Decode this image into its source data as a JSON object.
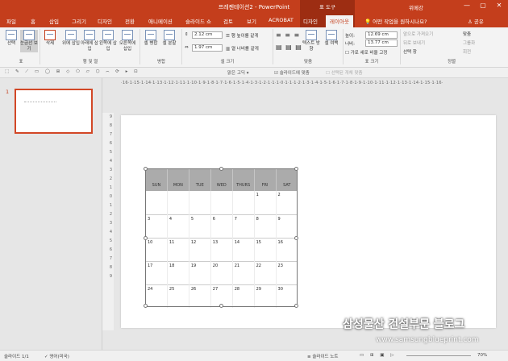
{
  "window": {
    "title": "프레젠테이션2 - PowerPoint",
    "context_group": "표 도구",
    "user": "위메강",
    "min": "—",
    "max": "▢",
    "close": "✕"
  },
  "tabs": {
    "file": "파일",
    "home": "홈",
    "insert": "삽입",
    "draw": "그리기",
    "design": "디자인",
    "transitions": "전환",
    "animations": "애니메이션",
    "slideshow": "슬라이드 쇼",
    "review": "검토",
    "view": "보기",
    "acrobat": "ACROBAT",
    "table_design": "디자인",
    "layout": "레이아웃",
    "search": "어떤 작업을 원하시나요?",
    "share": "공유"
  },
  "ribbon": {
    "select": "선택",
    "gridlines": "눈금선 보기",
    "delete": "삭제",
    "insert_above": "위에 삽입",
    "insert_below": "아래에 삽입",
    "insert_left": "왼쪽에 삽입",
    "insert_right": "오른쪽에 삽입",
    "merge_cells": "셀 병합",
    "split_cells": "셀 분할",
    "height_value": "2.12 cm",
    "width_value": "1.97 cm",
    "distribute_rows": "행 높이를 같게",
    "distribute_cols": "열 너비를 같게",
    "text_direction": "텍스트 방향",
    "cell_margins": "셀 여백",
    "tbl_height_label": "높이:",
    "tbl_height": "12.69 cm",
    "tbl_width_label": "너비:",
    "tbl_width": "13.77 cm",
    "lock_aspect": "가로 세로 비율 고정",
    "bring_forward": "앞으로 가져오기",
    "send_backward": "뒤로 보내기",
    "selection_pane": "선택 창",
    "align": "맞춤",
    "group": "그룹화",
    "rotate": "회전",
    "groups": {
      "table": "표",
      "rows_cols": "행 및 열",
      "merge": "병합",
      "cell_size": "셀 크기",
      "alignment": "맞춤",
      "table_size": "표 크기",
      "arrange": "정렬"
    }
  },
  "qat": {
    "font": "맑은 고딕",
    "snap": "슬라이드에 맞춤",
    "dim": "선택된 개체 맞춤"
  },
  "ruler": {
    "h": "·16·1·15·1·14·1·13·1·12·1·11·1·10·1·9·1·8·1·7·1·6·1·5·1·4·1·3·1·2·1·1·1·0·1·1·1·2·1·3·1·4·1·5·1·6·1·7·1·8·1·9·1·10·1·11·1·12·1·13·1·14·1·15·1·16·",
    "v": "9 8 7 6 5 4 3 2 1 0 1 2 3 4 5 6 7 8 9"
  },
  "thumbs": {
    "num": "1"
  },
  "calendar": {
    "days": [
      "SUN",
      "MON",
      "TUE",
      "WED",
      "THURS",
      "FRI",
      "SAT"
    ],
    "rows": [
      [
        "",
        "",
        "",
        "",
        "",
        "1",
        "2"
      ],
      [
        "3",
        "4",
        "5",
        "6",
        "7",
        "8",
        "9"
      ],
      [
        "10",
        "11",
        "12",
        "13",
        "14",
        "15",
        "16"
      ],
      [
        "17",
        "18",
        "19",
        "20",
        "21",
        "22",
        "23"
      ],
      [
        "24",
        "25",
        "26",
        "27",
        "28",
        "29",
        "30"
      ]
    ]
  },
  "status": {
    "slide": "슬라이드 1/1",
    "lang": "영어(미국)",
    "notes": "슬라이드 노트",
    "zoom": "70%"
  },
  "watermark": {
    "line1": "삼성물산 건설부문 블로그",
    "line2": "www.samsungblueprint.com"
  }
}
